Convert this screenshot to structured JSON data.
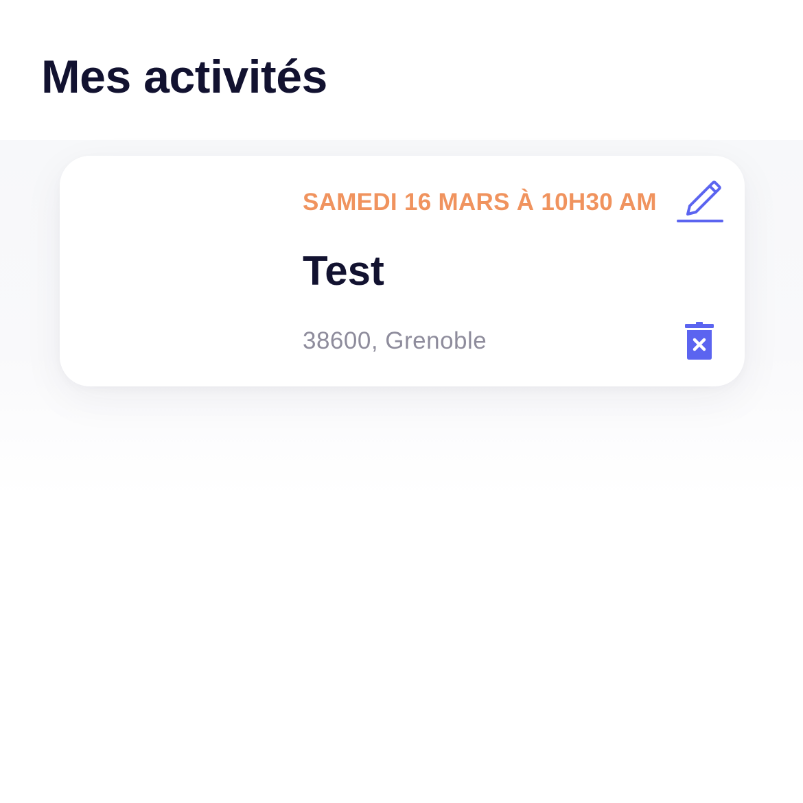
{
  "header": {
    "title": "Mes activités"
  },
  "activities": [
    {
      "date": "SAMEDI 16 MARS À 10H30 AM",
      "title": "Test",
      "location": "38600, Grenoble",
      "edit_icon": "pencil-icon",
      "delete_icon": "trash-x-icon"
    }
  ],
  "colors": {
    "title_text": "#121230",
    "date_accent": "#f0935e",
    "secondary_text": "#8e8c9c",
    "icon_accent": "#5b64f0",
    "card_background": "#ffffff",
    "list_background": "#f7f8fa"
  }
}
